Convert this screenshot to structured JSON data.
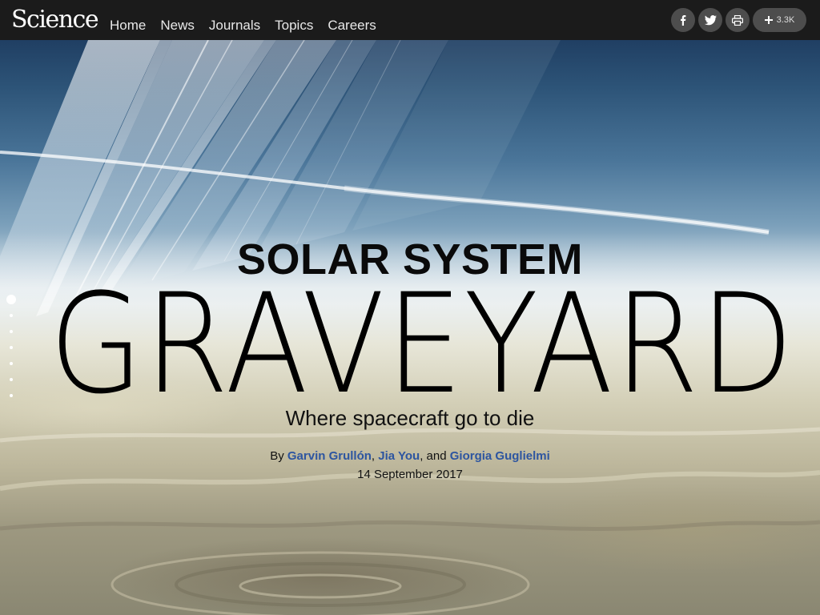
{
  "header": {
    "logo": "Science",
    "nav": [
      "Home",
      "News",
      "Journals",
      "Topics",
      "Careers"
    ],
    "share": {
      "facebook_icon": "facebook-icon",
      "twitter_icon": "twitter-icon",
      "print_icon": "print-icon",
      "plus_icon": "plus-icon",
      "count": "3.3K"
    }
  },
  "hero": {
    "kicker": "SOLAR SYSTEM",
    "title": "GRAVEYARD",
    "subtitle": "Where spacecraft go to die",
    "byline": {
      "prefix": "By ",
      "authors": [
        "Garvin Grullón",
        "Jia You",
        "Giorgia Guglielmi"
      ],
      "sep1": ", ",
      "sep2": ", and "
    },
    "date": "14 September 2017"
  },
  "section_nav": {
    "active_index": 0,
    "count": 7
  },
  "colors": {
    "header_bg": "#1b1b1b",
    "author_link": "#2d55a0",
    "share_button_bg": "#4d4d4d"
  }
}
